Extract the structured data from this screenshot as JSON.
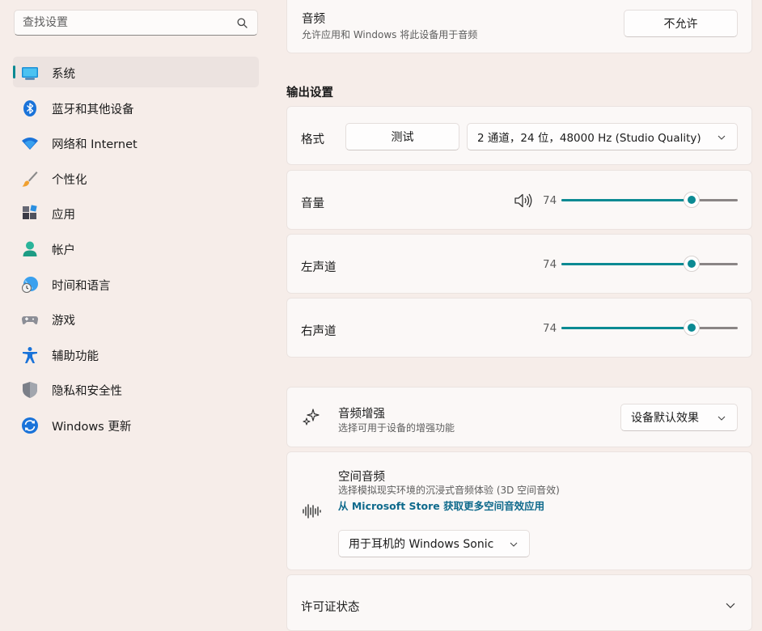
{
  "search": {
    "placeholder": "查找设置"
  },
  "sidebar": {
    "items": [
      {
        "label": "系统",
        "icon": "system-icon",
        "active": true
      },
      {
        "label": "蓝牙和其他设备",
        "icon": "bluetooth-icon"
      },
      {
        "label": "网络和 Internet",
        "icon": "wifi-icon"
      },
      {
        "label": "个性化",
        "icon": "brush-icon"
      },
      {
        "label": "应用",
        "icon": "apps-icon"
      },
      {
        "label": "帐户",
        "icon": "account-icon"
      },
      {
        "label": "时间和语言",
        "icon": "globe-clock-icon"
      },
      {
        "label": "游戏",
        "icon": "gamepad-icon"
      },
      {
        "label": "辅助功能",
        "icon": "accessibility-icon"
      },
      {
        "label": "隐私和安全性",
        "icon": "shield-icon"
      },
      {
        "label": "Windows 更新",
        "icon": "update-icon"
      }
    ]
  },
  "audio_card": {
    "title": "音频",
    "subtitle": "允许应用和 Windows 将此设备用于音频",
    "button": "不允许"
  },
  "output": {
    "heading": "输出设置",
    "format_label": "格式",
    "test_button": "测试",
    "format_value": "2 通道，24 位，48000 Hz (Studio Quality)",
    "volume": {
      "label": "音量",
      "value": 74,
      "icon": "speaker-icon"
    },
    "left": {
      "label": "左声道",
      "value": 74
    },
    "right": {
      "label": "右声道",
      "value": 74
    }
  },
  "enhance": {
    "title": "音频增强",
    "subtitle": "选择可用于设备的增强功能",
    "dropdown": "设备默认效果",
    "icon": "sparkle-icon"
  },
  "spatial": {
    "title": "空间音频",
    "subtitle": "选择模拟现实环境的沉浸式音频体验 (3D 空间音效)",
    "link": "从 Microsoft Store 获取更多空间音效应用",
    "dropdown": "用于耳机的 Windows Sonic",
    "icon": "soundwave-icon"
  },
  "license": {
    "title": "许可证状态"
  },
  "colors": {
    "accent": "#0b8a93",
    "background": "#f6ede9",
    "card": "#fbf8f7"
  }
}
